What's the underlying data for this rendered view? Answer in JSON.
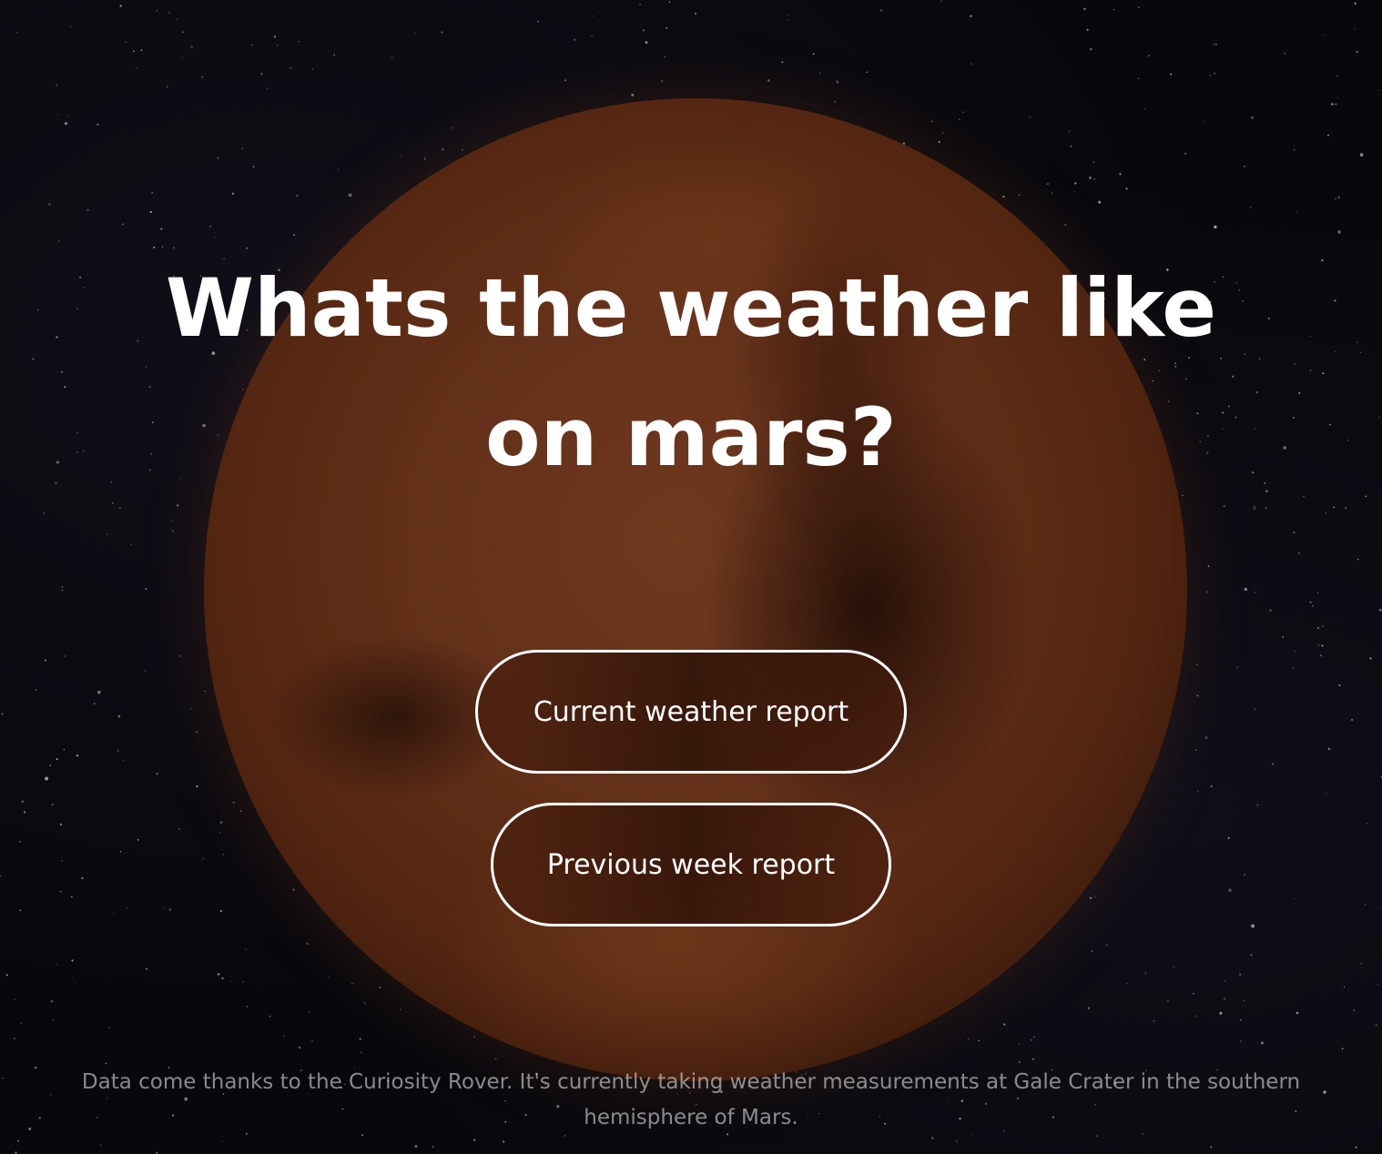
{
  "hero": {
    "title": "Whats the weather like on mars?"
  },
  "actions": {
    "current_label": "Current weather report",
    "previous_label": "Previous week report"
  },
  "footer": {
    "note": "Data come thanks to the Curiosity Rover. It's currently taking weather measurements at Gale Crater in the southern hemisphere of Mars."
  },
  "colors": {
    "text": "#ffffff",
    "background": "#0c0b10",
    "planet": "#8a4323"
  }
}
